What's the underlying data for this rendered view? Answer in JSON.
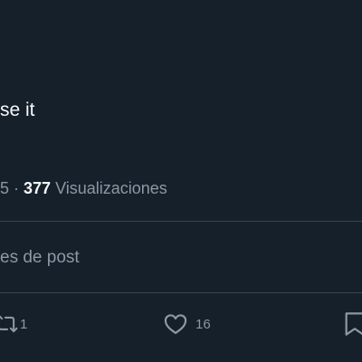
{
  "tweet": {
    "text": "se it"
  },
  "meta": {
    "leading": "5 · ",
    "views_count": "377",
    "views_label": " Visualizaciones"
  },
  "post_details": {
    "label": "es de post"
  },
  "actions": {
    "retweet_count": "1",
    "like_count": "16"
  },
  "colors": {
    "background": "#15202b",
    "text_primary": "#f7f9f9",
    "text_secondary": "#8b98a5",
    "divider": "#38444d"
  },
  "icons": {
    "retweet": "retweet-icon",
    "like": "heart-icon",
    "bookmark": "bookmark-icon"
  }
}
